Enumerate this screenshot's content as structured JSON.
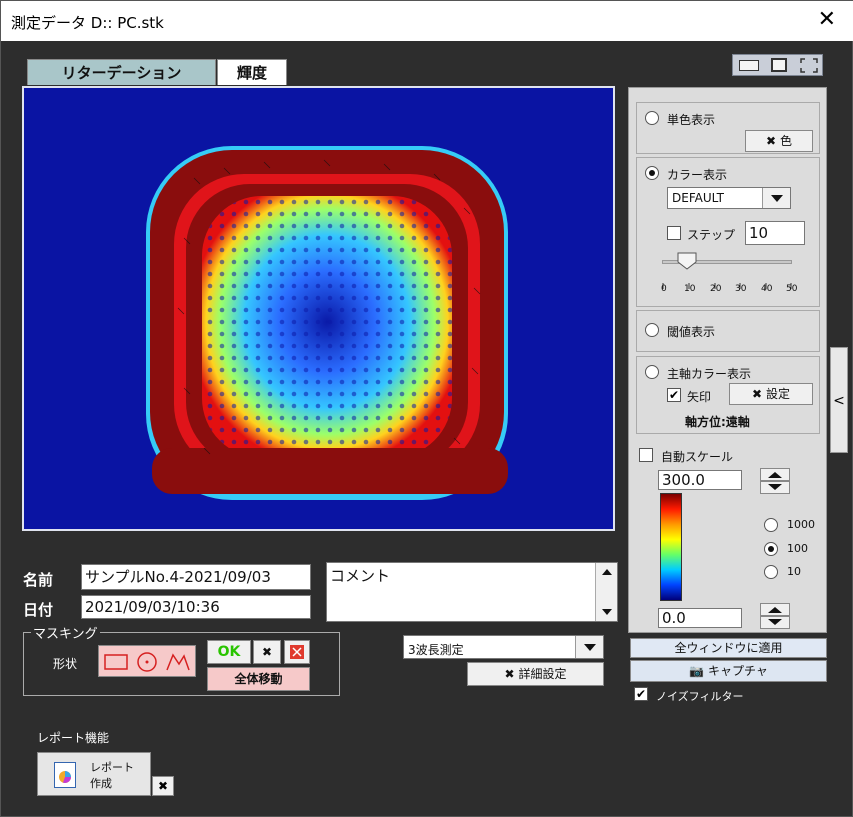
{
  "window": {
    "title": "測定データ D::  PC.stk",
    "close": "✕"
  },
  "tabs": [
    {
      "label": "リターデーション"
    },
    {
      "label": "輝度"
    }
  ],
  "right_panel": {
    "mono": {
      "label": "単色表示",
      "button": "色"
    },
    "color": {
      "label": "カラー表示",
      "palette": "DEFAULT",
      "step_label": "ステップ",
      "step_value": "10",
      "slider_ticks": [
        "0",
        "10",
        "20",
        "30",
        "40",
        "50"
      ],
      "slider_value": 10
    },
    "threshold": {
      "label": "閾値表示"
    },
    "axis_color": {
      "label": "主軸カラー表示",
      "arrow_label": "矢印",
      "settings": "設定",
      "axis_direction": "軸方位:遠軸"
    },
    "auto_scale": {
      "label": "自動スケール",
      "max": "300.0",
      "min": "0.0",
      "ranges": [
        "1000",
        "100",
        "10"
      ],
      "selected_range": "100"
    },
    "apply_all": "全ウィンドウに適用",
    "capture": "キャプチャ",
    "noise_filter": "ノイズフィルター",
    "side_handle": "<"
  },
  "info": {
    "name_label": "名前",
    "name_value": "サンプルNo.4-2021/09/03",
    "date_label": "日付",
    "date_value": "2021/09/03/10:36",
    "comment": "コメント"
  },
  "masking": {
    "title": "マスキング",
    "shape_label": "形状",
    "ok": "OK",
    "move_all": "全体移動"
  },
  "measure": {
    "mode": "3波長測定",
    "detail": "詳細設定"
  },
  "report": {
    "section": "レポート機能",
    "button_line1": "レポート",
    "button_line2": "作成"
  },
  "colors": {
    "accent_green": "#29c400",
    "cancel_red": "#e03a2e",
    "move_bg": "#f6c9c9"
  }
}
